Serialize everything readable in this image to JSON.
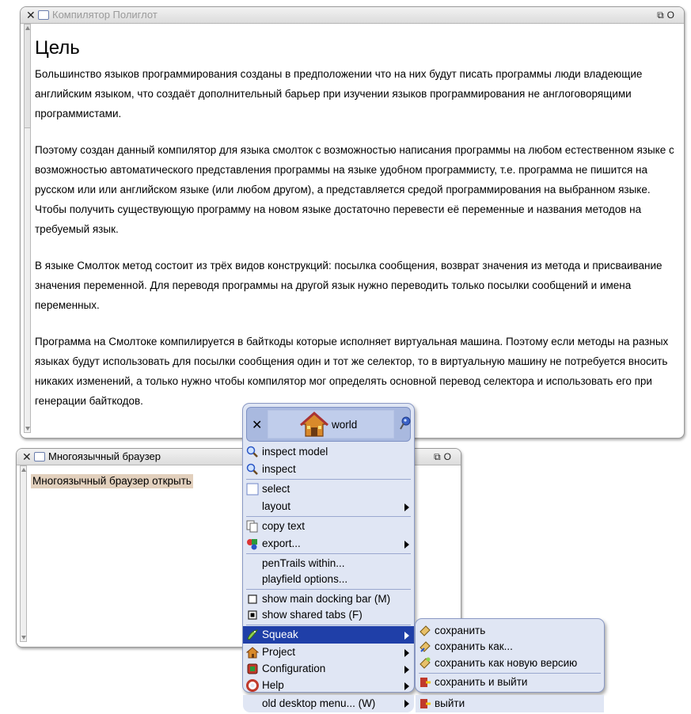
{
  "compiler_window": {
    "title": "Компилятор Полиглот",
    "heading": "Цель",
    "paragraphs": [
      "Большинство языков программирования созданы в предположении что на них будут писать программы люди владеющие английским языком, что создаёт дополнительный барьер при изучении языков программирования не англоговорящими программистами.",
      "Поэтому создан данный компилятор для языка смолток с возможностью написания программы на любом естественном языке с возможностью автоматического представления программы на языке удобном программисту, т.е. программа не пишится на русском или или английском языке (или любом другом), а представляется средой программирования на выбранном языке. Чтобы получить существующую программу на новом языке достаточно перевести её переменные и названия методов на требуемый язык.",
      "В языке Смолток метод состоит из трёх видов конструкций: посылка сообщения, возврат значения из метода и присваивание значения переменной. Для переводя программы на другой язык нужно переводить только посылки сообщений и имена переменных.",
      "Программа на Смолтоке компилируется в байткоды которые исполняет виртуальная машина. Поэтому если методы на разных языках будут использовать для посылки сообщения один и тот же селектор, то в виртуальную машину не потребуется вносить никаких изменений, а только нужно чтобы компилятор мог определять основной перевод селектора и использовать его при генерации байткодов."
    ]
  },
  "browser_window": {
    "title": "Многоязычный браузер",
    "link": "Многоязычный браузер открыть"
  },
  "world_menu": {
    "title": "world",
    "items": [
      {
        "label": "inspect model"
      },
      {
        "label": "inspect"
      },
      {
        "label": "select"
      },
      {
        "label": "layout"
      },
      {
        "label": "copy text"
      },
      {
        "label": "export..."
      },
      {
        "label": "penTrails within..."
      },
      {
        "label": "playfield options..."
      },
      {
        "label": "show main docking bar (M)"
      },
      {
        "label": "show shared tabs (F)"
      },
      {
        "label": "Squeak"
      },
      {
        "label": "Project"
      },
      {
        "label": "Configuration"
      },
      {
        "label": "Help"
      },
      {
        "label": "old desktop menu... (W)"
      }
    ]
  },
  "squeak_submenu": {
    "items": [
      {
        "label": "сохранить"
      },
      {
        "label": "сохранить как..."
      },
      {
        "label": "сохранить как новую версию"
      },
      {
        "label": "сохранить и выйти"
      },
      {
        "label": "выйти"
      }
    ]
  },
  "colors": {
    "menu_bg": "#e0e6f4",
    "menu_selected": "#1f3fa8",
    "link_highlight": "#e2d0bd"
  }
}
